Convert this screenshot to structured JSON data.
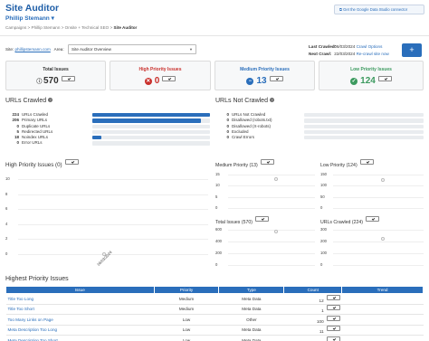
{
  "header": {
    "title": "Site Auditor",
    "user": "Phillip Stemann",
    "breadcrumbs": [
      "Campaigns",
      "Phillip Stemann",
      "Onsite + Technical SEO"
    ],
    "current": "Site Auditor",
    "gds_button": "Get the Google Data Studio connector"
  },
  "filters": {
    "site_label": "Site:",
    "site_value": "phillipstemann.com",
    "area_label": "Area:",
    "area_value": "Site Auditor Overview",
    "last_crawled_label": "Last Crawled:",
    "last_crawled_date": "06/03/2024",
    "crawl_options": "Crawl Options",
    "next_crawl_label": "Next Crawl:",
    "next_crawl_date": "22/03/2024",
    "recrawl": "Re-crawl site now",
    "add_button": "+"
  },
  "cards": [
    {
      "label": "Total Issues",
      "value": "570",
      "icon": "",
      "color": "#333333"
    },
    {
      "label": "High Priority Issues",
      "value": "0",
      "icon": "x-circle-icon",
      "color": "#c9302c"
    },
    {
      "label": "Medium Priority Issues",
      "value": "13",
      "icon": "minus-circle-icon",
      "color": "#2a6ebb"
    },
    {
      "label": "Low Priority Issues",
      "value": "124",
      "icon": "check-circle-icon",
      "color": "#3c9a5f"
    }
  ],
  "urls_crawled": {
    "title": "URLs Crawled",
    "rows": [
      {
        "count": "224",
        "label": "URLs Crawled",
        "fraction": 1.0
      },
      {
        "count": "206",
        "label": "Primary URLs",
        "fraction": 0.92
      },
      {
        "count": "0",
        "label": "Duplicate URLs",
        "fraction": 0
      },
      {
        "count": "5",
        "label": "Redirected URLs",
        "fraction": 0
      },
      {
        "count": "18",
        "label": "Noindex URLs",
        "fraction": 0.08
      },
      {
        "count": "0",
        "label": "Error URLs",
        "fraction": 0
      }
    ]
  },
  "urls_not_crawled": {
    "title": "URLs Not Crawled",
    "rows": [
      {
        "count": "0",
        "label": "URLs Not Crawled",
        "fraction": 0
      },
      {
        "count": "0",
        "label": "Disallowed (robots.txt)",
        "fraction": 0
      },
      {
        "count": "0",
        "label": "Disallowed (X-robots)",
        "fraction": 0
      },
      {
        "count": "0",
        "label": "Excluded",
        "fraction": 0
      },
      {
        "count": "0",
        "label": "Crawl Errors",
        "fraction": 0
      }
    ]
  },
  "charts": {
    "high_priority": {
      "title": "High Priority Issues",
      "count": "(0)"
    },
    "medium_priority": {
      "title": "Medium Priority",
      "count": "(13)"
    },
    "low_priority": {
      "title": "Low Priority",
      "count": "(124)"
    },
    "total_issues": {
      "title": "Total Issues",
      "count": "(570)"
    },
    "urls_crawled": {
      "title": "URLs Crawled",
      "count": "(224)"
    }
  },
  "chart_data": [
    {
      "type": "scatter",
      "title": "High Priority Issues (0)",
      "x": [
        "06/03/2024"
      ],
      "y": [
        0
      ],
      "yticks": [
        "10",
        "8",
        "6",
        "4",
        "2",
        "0"
      ],
      "ylim": [
        0,
        10
      ]
    },
    {
      "type": "scatter",
      "title": "Medium Priority (13)",
      "x": [
        "06/03/2024"
      ],
      "y": [
        13
      ],
      "yticks": [
        "15",
        "10",
        "5",
        "0"
      ],
      "ylim": [
        0,
        15
      ]
    },
    {
      "type": "scatter",
      "title": "Low Priority (124)",
      "x": [
        "06/03/2024"
      ],
      "y": [
        124
      ],
      "yticks": [
        "150",
        "100",
        "50",
        "0"
      ],
      "ylim": [
        0,
        150
      ]
    },
    {
      "type": "scatter",
      "title": "Total Issues (570)",
      "x": [
        "06/03/2024"
      ],
      "y": [
        570
      ],
      "yticks": [
        "600",
        "400",
        "200",
        "0"
      ],
      "ylim": [
        0,
        600
      ]
    },
    {
      "type": "scatter",
      "title": "URLs Crawled (224)",
      "x": [
        "06/03/2024"
      ],
      "y": [
        224
      ],
      "yticks": [
        "300",
        "200",
        "100",
        "0"
      ],
      "ylim": [
        0,
        300
      ]
    }
  ],
  "table": {
    "title": "Highest Priority Issues",
    "columns": [
      "Issue",
      "Priority",
      "Type",
      "Count",
      "Trend"
    ],
    "rows": [
      {
        "issue": "Title Too Long",
        "priority": "Medium",
        "type": "Meta Data",
        "count": "12"
      },
      {
        "issue": "Title Too Short",
        "priority": "Medium",
        "type": "Meta Data",
        "count": "1"
      },
      {
        "issue": "Too Many Links on Page",
        "priority": "Low",
        "type": "Other",
        "count": "100"
      },
      {
        "issue": "Meta Description Too Long",
        "priority": "Low",
        "type": "Meta Data",
        "count": "11"
      },
      {
        "issue": "Meta Description Too Short",
        "priority": "Low",
        "type": "Meta Data",
        "count": "1"
      }
    ]
  }
}
